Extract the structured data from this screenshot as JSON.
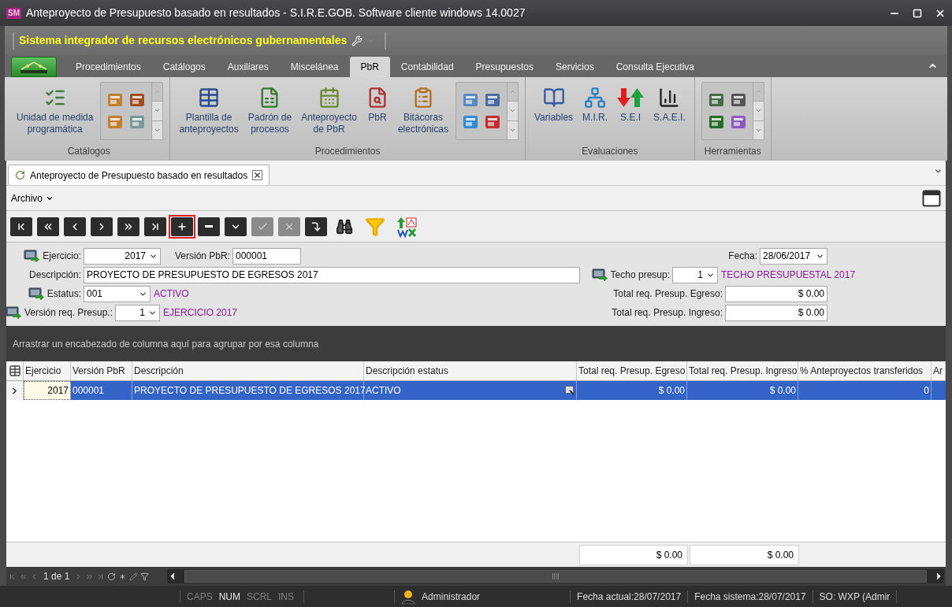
{
  "window": {
    "logo": "SM",
    "title": "Anteproyecto de Presupuesto basado en resultados - S.I.R.E.GOB. Software cliente windows 14.0027"
  },
  "quick_access": {
    "title": "Sistema integrador de recursos electrónicos gubernamentales"
  },
  "ribbon": {
    "tabs": [
      {
        "label": "Procedimientos",
        "selected": false
      },
      {
        "label": "Catálogos",
        "selected": false
      },
      {
        "label": "Auxiliares",
        "selected": false
      },
      {
        "label": "Miscelánea",
        "selected": false
      },
      {
        "label": "PbR",
        "selected": true
      },
      {
        "label": "Contabilidad",
        "selected": false
      },
      {
        "label": "Presupuestos",
        "selected": false
      },
      {
        "label": "Servicios",
        "selected": false
      },
      {
        "label": "Consulta Ejecutiva",
        "selected": false
      }
    ],
    "groups": [
      {
        "label": "Catálogos",
        "items": [
          {
            "kind": "button",
            "label": "Unidad de medida\nprogramática"
          },
          {
            "kind": "gallery"
          }
        ]
      },
      {
        "label": "Procedimientos",
        "items": [
          {
            "kind": "button",
            "label": "Plantilla de\nanteproyectos"
          },
          {
            "kind": "button",
            "label": "Padrón de\nprocesos"
          },
          {
            "kind": "button",
            "label": "Anteproyecto\nde PbR"
          },
          {
            "kind": "button",
            "label": "PbR"
          },
          {
            "kind": "button",
            "label": "Bitácoras\nelectrónicas"
          },
          {
            "kind": "gallery"
          }
        ]
      },
      {
        "label": "Evaluaciones",
        "items": [
          {
            "kind": "button",
            "label": "Variables"
          },
          {
            "kind": "button",
            "label": "M.I.R."
          },
          {
            "kind": "button",
            "label": "S.E.I"
          },
          {
            "kind": "button",
            "label": "S.A.E.I."
          }
        ]
      },
      {
        "label": "Herramientas",
        "items": [
          {
            "kind": "gallery"
          }
        ]
      }
    ]
  },
  "document_tabs": [
    {
      "label": "Anteproyecto de Presupuesto basado en resultados",
      "selected": true
    }
  ],
  "menu": {
    "label": "Archivo"
  },
  "toolbar": [
    {
      "kind": "first",
      "disabled": false,
      "highlighted": false
    },
    {
      "kind": "prev-page",
      "disabled": false,
      "highlighted": false
    },
    {
      "kind": "prev",
      "disabled": false,
      "highlighted": false
    },
    {
      "kind": "next",
      "disabled": false,
      "highlighted": false
    },
    {
      "kind": "next-page",
      "disabled": false,
      "highlighted": false
    },
    {
      "kind": "last",
      "disabled": false,
      "highlighted": false
    },
    {
      "kind": "add",
      "disabled": false,
      "highlighted": true
    },
    {
      "kind": "remove",
      "disabled": false,
      "highlighted": false
    },
    {
      "kind": "edit",
      "disabled": false,
      "highlighted": false
    },
    {
      "kind": "confirm",
      "disabled": true,
      "highlighted": false
    },
    {
      "kind": "cancel",
      "disabled": true,
      "highlighted": false
    },
    {
      "kind": "refresh",
      "disabled": false,
      "highlighted": false
    },
    {
      "kind": "search",
      "disabled": false,
      "highlighted": false
    },
    {
      "kind": "filter",
      "disabled": false,
      "highlighted": false
    },
    {
      "kind": "export",
      "disabled": false,
      "highlighted": false
    }
  ],
  "form": {
    "fields": [
      {
        "label": "Ejercicio:",
        "value": "2017",
        "kind": "number-dropdown",
        "linked": true
      },
      {
        "label": "Versión PbR:",
        "value": "000001",
        "kind": "text",
        "linked": false
      },
      {
        "label": "Fecha:",
        "value": "28/06/2017",
        "kind": "dropdown",
        "linked": false
      },
      {
        "label": "Descripción:",
        "value": "PROYECTO DE PRESUPUESTO DE EGRESOS 2017",
        "kind": "text",
        "linked": false
      },
      {
        "label": "Techo presup:",
        "value": "1",
        "kind": "number-dropdown",
        "linked": true,
        "note": "TECHO PRESUPUESTAL 2017"
      },
      {
        "label": "Estatus:",
        "value": "001",
        "kind": "dropdown",
        "linked": true,
        "note": "ACTIVO"
      },
      {
        "label": "Total req. Presup. Egreso:",
        "value": "$ 0.00",
        "kind": "currency",
        "linked": false
      },
      {
        "label": "Versión req. Presup.:",
        "value": "1",
        "kind": "number-dropdown",
        "linked": true,
        "note": "EJERCICIO 2017"
      },
      {
        "label": "Total req. Presup. Ingreso:",
        "value": "$ 0.00",
        "kind": "currency",
        "linked": false
      }
    ]
  },
  "grid": {
    "group_hint": "Arrastrar un encabezado de columna aquí para agrupar por esa columna",
    "columns": [
      "Ejercicio",
      "Versión PbR",
      "Descripción",
      "Descripción estatus",
      "Total req. Presup. Egreso",
      "Total req. Presup. Ingreso",
      "% Anteproyectos transferidos",
      "Ar"
    ],
    "rows": [
      {
        "selected": true,
        "cells": [
          "2017",
          "000001",
          "PROYECTO DE PRESUPUESTO DE EGRESOS 2017",
          "ACTIVO",
          "$ 0.00",
          "$ 0.00",
          "0",
          ""
        ]
      }
    ],
    "totals": [
      "$ 0.00",
      "$ 0.00"
    ],
    "navigator": "1 de 1"
  },
  "status_bar": {
    "keys": [
      {
        "label": "CAPS",
        "on": false
      },
      {
        "label": "NUM",
        "on": true
      },
      {
        "label": "SCRL",
        "on": false
      },
      {
        "label": "INS",
        "on": false
      }
    ],
    "user": "Administrador",
    "items": [
      "Fecha actual:28/07/2017",
      "Fecha sistema:28/07/2017",
      "SO: WXP (Admir"
    ]
  }
}
